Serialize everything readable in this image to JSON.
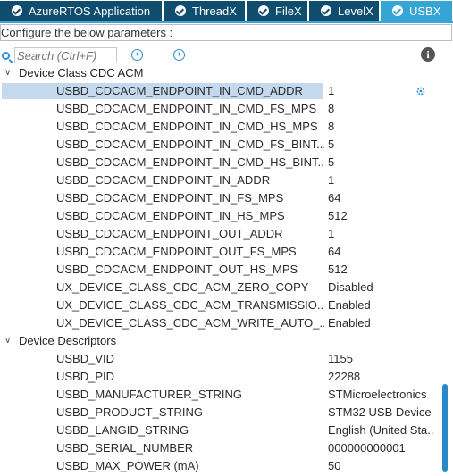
{
  "tabs": [
    {
      "label": "AzureRTOS Application",
      "active": false
    },
    {
      "label": "ThreadX",
      "active": false
    },
    {
      "label": "FileX",
      "active": false
    },
    {
      "label": "LevelX",
      "active": false
    },
    {
      "label": "USBX",
      "active": true
    }
  ],
  "config_header": "Configure the below parameters :",
  "search": {
    "placeholder": "Search (Ctrl+F)"
  },
  "icons": {
    "prev": "chevron-left-circle-icon",
    "next": "chevron-right-circle-icon",
    "info": "info-icon",
    "gear": "gear-icon"
  },
  "colors": {
    "tab_bg": "#0f4d6f",
    "tab_active": "#35a5d6",
    "selection": "#c4d8ee",
    "accent": "#2f8fd8"
  },
  "groups": [
    {
      "name": "Device Class CDC ACM",
      "params": [
        {
          "name": "USBD_CDCACM_ENDPOINT_IN_CMD_ADDR",
          "value": "1",
          "selected": true
        },
        {
          "name": "USBD_CDCACM_ENDPOINT_IN_CMD_FS_MPS",
          "value": "8"
        },
        {
          "name": "USBD_CDCACM_ENDPOINT_IN_CMD_HS_MPS",
          "value": "8"
        },
        {
          "name": "USBD_CDCACM_ENDPOINT_IN_CMD_FS_BINT...",
          "value": "5"
        },
        {
          "name": "USBD_CDCACM_ENDPOINT_IN_CMD_HS_BINT...",
          "value": "5"
        },
        {
          "name": "USBD_CDCACM_ENDPOINT_IN_ADDR",
          "value": "1"
        },
        {
          "name": "USBD_CDCACM_ENDPOINT_IN_FS_MPS",
          "value": "64"
        },
        {
          "name": "USBD_CDCACM_ENDPOINT_IN_HS_MPS",
          "value": "512"
        },
        {
          "name": "USBD_CDCACM_ENDPOINT_OUT_ADDR",
          "value": "1"
        },
        {
          "name": "USBD_CDCACM_ENDPOINT_OUT_FS_MPS",
          "value": "64"
        },
        {
          "name": "USBD_CDCACM_ENDPOINT_OUT_HS_MPS",
          "value": "512"
        },
        {
          "name": "UX_DEVICE_CLASS_CDC_ACM_ZERO_COPY",
          "value": "Disabled"
        },
        {
          "name": "UX_DEVICE_CLASS_CDC_ACM_TRANSMISSIO...",
          "value": "Enabled"
        },
        {
          "name": "UX_DEVICE_CLASS_CDC_ACM_WRITE_AUTO_...",
          "value": "Enabled"
        }
      ]
    },
    {
      "name": "Device Descriptors",
      "params": [
        {
          "name": "USBD_VID",
          "value": "1155"
        },
        {
          "name": "USBD_PID",
          "value": "22288"
        },
        {
          "name": "USBD_MANUFACTURER_STRING",
          "value": "STMicroelectronics"
        },
        {
          "name": "USBD_PRODUCT_STRING",
          "value": "STM32 USB Device"
        },
        {
          "name": "USBD_LANGID_STRING",
          "value": "English (United Sta..."
        },
        {
          "name": "USBD_SERIAL_NUMBER",
          "value": "000000000001"
        },
        {
          "name": "USBD_MAX_POWER (mA)",
          "value": "50"
        }
      ]
    }
  ]
}
